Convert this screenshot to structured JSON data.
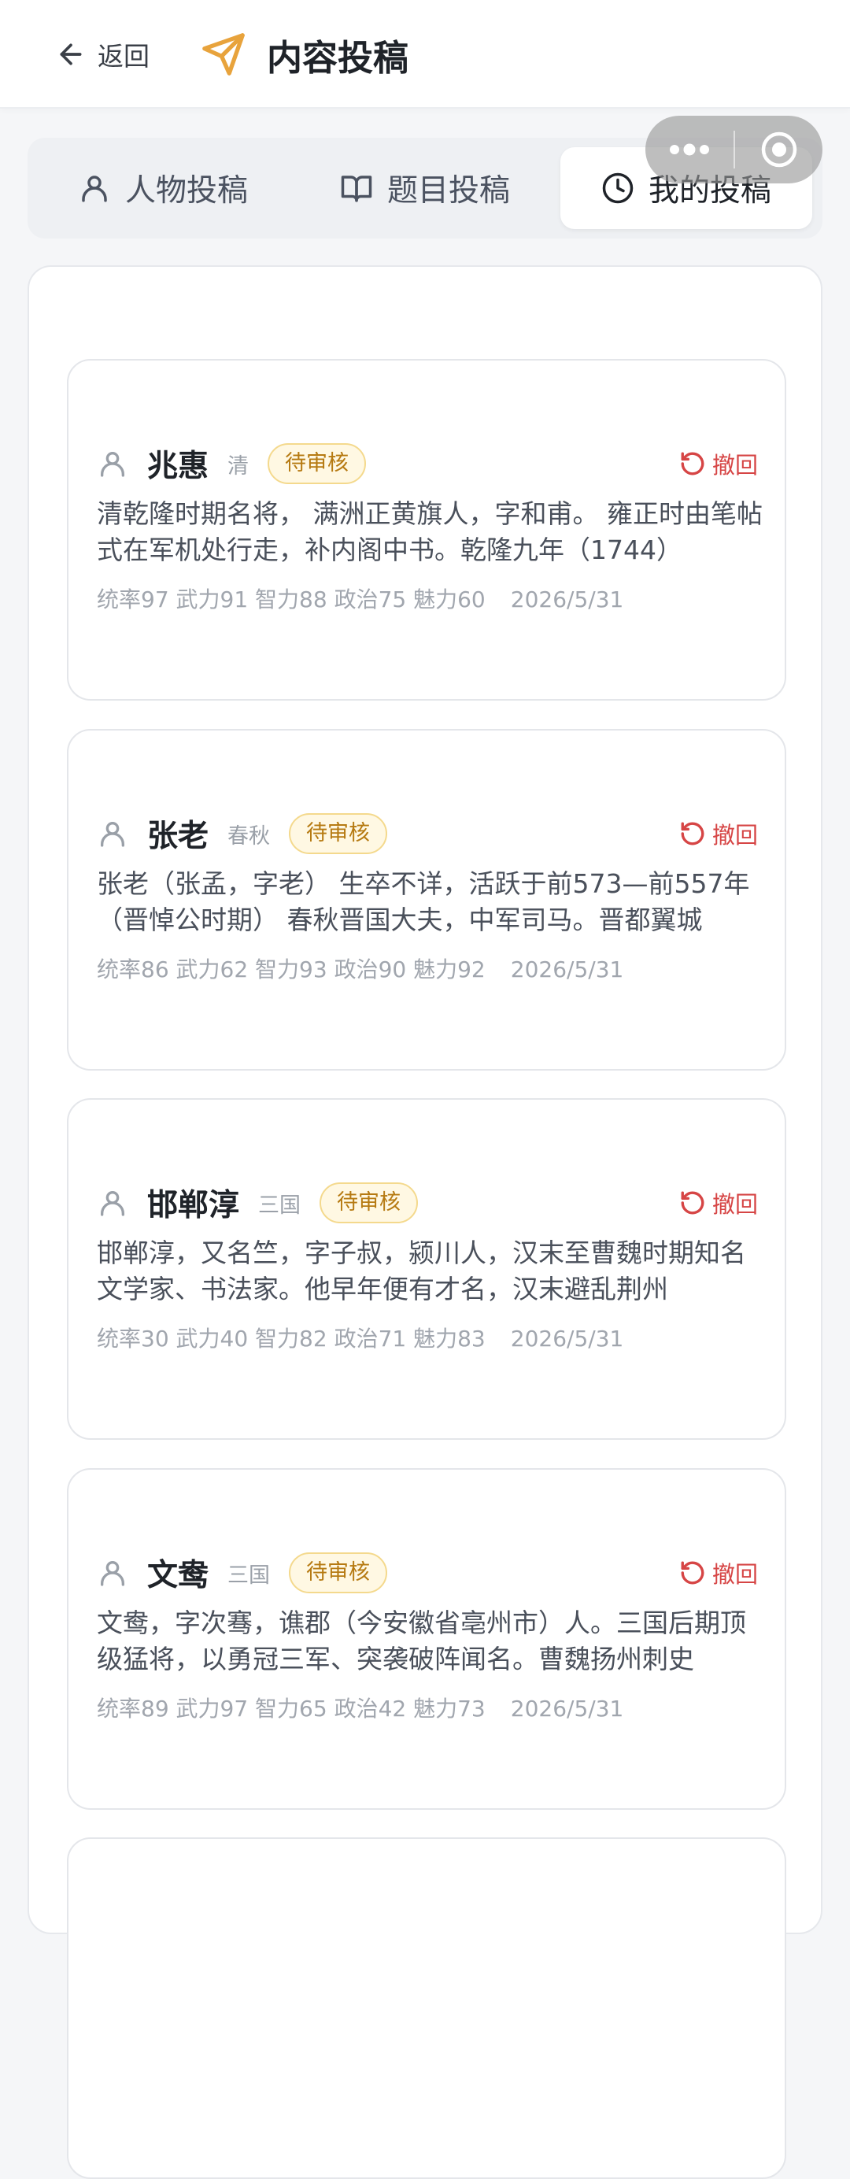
{
  "header": {
    "back_label": "返回",
    "title": "内容投稿",
    "title_icon_color": "#e8a33c"
  },
  "tabs": [
    {
      "label": "人物投稿",
      "icon": "person-icon",
      "active": false
    },
    {
      "label": "题目投稿",
      "icon": "book-icon",
      "active": false
    },
    {
      "label": "我的投稿",
      "icon": "clock-icon",
      "active": true
    }
  ],
  "submissions": [
    {
      "name": "兆惠",
      "era": "清",
      "status": "待审核",
      "withdraw_label": "撤回",
      "description": "清乾隆时期名将， 满洲正黄旗人，字和甫。 雍正时由笔帖式在军机处行走，补内阁中书。乾隆九年（1744）",
      "stats": "统率97 武力91 智力88 政治75 魅力60",
      "date": "2026/5/31"
    },
    {
      "name": "张老",
      "era": "春秋",
      "status": "待审核",
      "withdraw_label": "撤回",
      "description": "张老（张孟，字老） 生卒不详，活跃于前573—前557年（晋悼公时期） 春秋晋国大夫，中军司马。晋都翼城",
      "stats": "统率86 武力62 智力93 政治90 魅力92",
      "date": "2026/5/31"
    },
    {
      "name": "邯郸淳",
      "era": "三国",
      "status": "待审核",
      "withdraw_label": "撤回",
      "description": "邯郸淳，又名竺，字子叔，颍川人，汉末至曹魏时期知名文学家、书法家。他早年便有才名，汉末避乱荆州",
      "stats": "统率30 武力40 智力82 政治71 魅力83",
      "date": "2026/5/31"
    },
    {
      "name": "文鸯",
      "era": "三国",
      "status": "待审核",
      "withdraw_label": "撤回",
      "description": "文鸯，字次骞，谯郡（今安徽省亳州市）人。三国后期顶级猛将，以勇冠三军、突袭破阵闻名。曹魏扬州刺史",
      "stats": "统率89 武力97 智力65 政治42 魅力73",
      "date": "2026/5/31"
    }
  ],
  "colors": {
    "accent": "#e8a33c",
    "badge_text": "#b67a12",
    "withdraw": "#d64545"
  }
}
